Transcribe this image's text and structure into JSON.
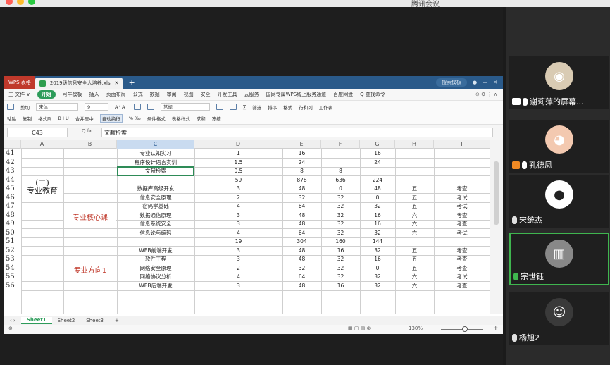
{
  "window": {
    "title": "腾讯会议"
  },
  "wps": {
    "app_tab": "WPS 表格",
    "file_tab": "2019级信息安全人培养.xls",
    "add_tab": "+",
    "search_hint": "搜索模板",
    "menu": [
      "三 文件 ∨",
      "开始",
      "可牛模板",
      "插入",
      "页面布局",
      "公式",
      "数据",
      "审阅",
      "视图",
      "安全",
      "开发工具",
      "云服务",
      "国网专属WPS线上服务通道",
      "百度网盘",
      "Q 查找命令"
    ],
    "ribbon_row1": [
      "剪切",
      "宋体",
      "9",
      "A⁺ A⁻",
      "常规",
      "∑",
      "筛选",
      "排序",
      "格式",
      "行和列",
      "工作表"
    ],
    "ribbon_row2": [
      "粘贴",
      "复制",
      "格式刷",
      "B I U",
      "合并居中",
      "自动换行",
      "% ‰",
      "条件格式",
      "表格样式",
      "求和",
      "冻结"
    ],
    "name_box": "C43",
    "fx": "Q  fx",
    "formula": "文献检索",
    "columns": [
      "A",
      "B",
      "C",
      "D",
      "E",
      "F",
      "G",
      "H",
      "I"
    ],
    "rows": [
      {
        "n": "41",
        "c": "专业认知实习",
        "d": "1",
        "e": "16",
        "f": "",
        "g": "16",
        "h": "",
        "i": ""
      },
      {
        "n": "42",
        "c": "程序设计语言实训",
        "d": "1.5",
        "e": "24",
        "f": "",
        "g": "24",
        "h": "",
        "i": ""
      },
      {
        "n": "43",
        "c": "文献检索",
        "d": "0.5",
        "e": "8",
        "f": "8",
        "g": "",
        "h": "",
        "i": ""
      },
      {
        "n": "44",
        "c": "",
        "d": "59",
        "e": "878",
        "f": "636",
        "g": "224",
        "h": "",
        "i": ""
      },
      {
        "n": "45",
        "c": "数据库高级开发",
        "d": "3",
        "e": "48",
        "f": "0",
        "g": "48",
        "h": "五",
        "i": "考查"
      },
      {
        "n": "46",
        "c": "信息安全原理",
        "d": "2",
        "e": "32",
        "f": "32",
        "g": "0",
        "h": "五",
        "i": "考试"
      },
      {
        "n": "47",
        "c": "密码学基础",
        "d": "4",
        "e": "64",
        "f": "32",
        "g": "32",
        "h": "五",
        "i": "考试"
      },
      {
        "n": "48",
        "c": "数据通信原理",
        "d": "3",
        "e": "48",
        "f": "32",
        "g": "16",
        "h": "六",
        "i": "考查"
      },
      {
        "n": "49",
        "c": "信息系统安全",
        "d": "3",
        "e": "48",
        "f": "32",
        "g": "16",
        "h": "六",
        "i": "考查"
      },
      {
        "n": "50",
        "c": "信息论与编码",
        "d": "4",
        "e": "64",
        "f": "32",
        "g": "32",
        "h": "六",
        "i": "考试"
      },
      {
        "n": "51",
        "c": "",
        "d": "19",
        "e": "304",
        "f": "160",
        "g": "144",
        "h": "",
        "i": ""
      },
      {
        "n": "52",
        "c": "WEB前端开发",
        "d": "3",
        "e": "48",
        "f": "16",
        "g": "32",
        "h": "五",
        "i": "考查"
      },
      {
        "n": "53",
        "c": "软件工程",
        "d": "3",
        "e": "48",
        "f": "32",
        "g": "16",
        "h": "五",
        "i": "考查"
      },
      {
        "n": "54",
        "c": "网络安全原理",
        "d": "2",
        "e": "32",
        "f": "32",
        "g": "0",
        "h": "五",
        "i": "考查"
      },
      {
        "n": "55",
        "c": "网络协议分析",
        "d": "4",
        "e": "64",
        "f": "32",
        "g": "32",
        "h": "六",
        "i": "考试"
      },
      {
        "n": "56",
        "c": "WEB后端开发",
        "d": "3",
        "e": "48",
        "f": "16",
        "g": "32",
        "h": "六",
        "i": "考查"
      }
    ],
    "group_a": "(二)\n专业教育",
    "group_a1": "(二)",
    "group_a2": "专业教育",
    "group_b1": "专业核心课",
    "group_b2": "专业方向1",
    "sheets": [
      "Sheet1",
      "Sheet2",
      "Sheet3",
      "+"
    ],
    "zoom": "130%"
  },
  "participants": [
    {
      "name": "谢莉萍的屏幕...",
      "mic_color": "#ffffff",
      "avatar_bg": "#d9cbb3",
      "avatar": "◉",
      "sharing": true,
      "active": false
    },
    {
      "name": "孔德凤",
      "mic_color": "#ffffff",
      "avatar_bg": "#f3c9b0",
      "avatar": "◕",
      "badge": true,
      "active": false
    },
    {
      "name": "宋统杰",
      "mic_color": "#e0e0e0",
      "avatar_bg": "#ffffff",
      "avatar": "●",
      "active": false
    },
    {
      "name": "宗世钰",
      "mic_color": "#3fb54f",
      "avatar_bg": "#888888",
      "avatar": "▥",
      "active": true
    },
    {
      "name": "杨旭2",
      "mic_color": "#e0e0e0",
      "avatar_bg": "#3a3a3a",
      "avatar": "☺",
      "active": false
    }
  ]
}
